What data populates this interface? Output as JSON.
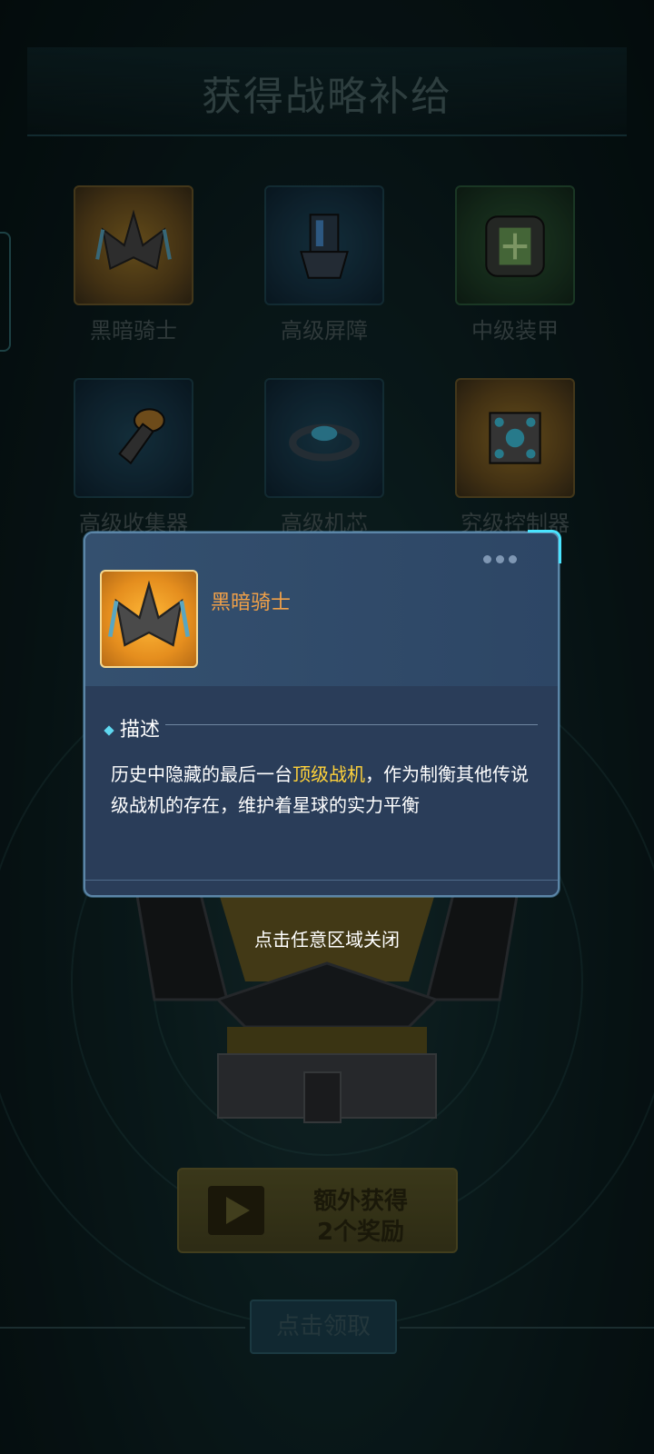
{
  "header": {
    "title": "获得战略补给"
  },
  "items": [
    {
      "label": "黑暗骑士",
      "style": "gold",
      "icon": "fighter-jet-icon"
    },
    {
      "label": "高级屏障",
      "style": "blue",
      "icon": "barrier-tower-icon"
    },
    {
      "label": "中级装甲",
      "style": "green",
      "icon": "armor-cuff-icon"
    },
    {
      "label": "高级收集器",
      "style": "blue",
      "icon": "collector-icon"
    },
    {
      "label": "高级机芯",
      "style": "blue",
      "icon": "core-ring-icon"
    },
    {
      "label": "究级控制器",
      "style": "gold",
      "icon": "controller-cube-icon"
    }
  ],
  "bonus": {
    "line1": "额外获得",
    "line2": "2个奖励"
  },
  "claim": {
    "label": "点击领取"
  },
  "popup": {
    "name": "黑暗骑士",
    "section": "描述",
    "desc_pre": "历史中隐藏的最后一台",
    "desc_highlight": "顶级战机",
    "desc_post": "，作为制衡其他传说级战机的存在，维护着星球的实力平衡",
    "highlight_color": "#ffd23a"
  },
  "close_hint": "点击任意区域关闭"
}
